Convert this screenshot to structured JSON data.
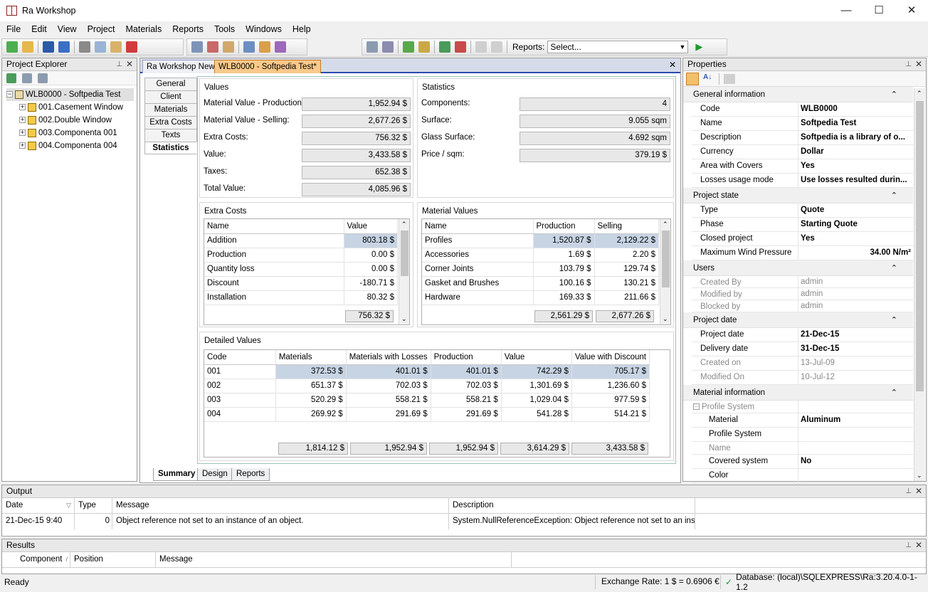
{
  "window": {
    "title": "Ra Workshop",
    "minimize": "—",
    "maximize": "☐",
    "close": "✕"
  },
  "menu": [
    "File",
    "Edit",
    "View",
    "Project",
    "Materials",
    "Reports",
    "Tools",
    "Windows",
    "Help"
  ],
  "toolbar": {
    "reports_label": "Reports:",
    "reports_select": "Select..."
  },
  "explorer": {
    "title": "Project Explorer",
    "root": "WLB0000 - Softpedia Test",
    "items": [
      "001.Casement Window",
      "002.Double Window",
      "003.Componenta 001",
      "004.Componenta 004"
    ]
  },
  "doc_tabs": [
    "Ra Workshop News",
    "WLB0000 - Softpedia Test*"
  ],
  "side_tabs": [
    "General",
    "Client",
    "Materials",
    "Extra Costs",
    "Texts",
    "Statistics"
  ],
  "values": {
    "title": "Values",
    "rows": [
      {
        "label": "Material Value - Production:",
        "value": "1,952.94 $"
      },
      {
        "label": "Material Value - Selling:",
        "value": "2,677.26 $"
      },
      {
        "label": "Extra Costs:",
        "value": "756.32 $"
      },
      {
        "label": "Value:",
        "value": "3,433.58 $"
      },
      {
        "label": "Taxes:",
        "value": "652.38 $"
      },
      {
        "label": "Total Value:",
        "value": "4,085.96 $"
      }
    ]
  },
  "statistics": {
    "title": "Statistics",
    "rows": [
      {
        "label": "Components:",
        "value": "4"
      },
      {
        "label": "Surface:",
        "value": "9.055 sqm"
      },
      {
        "label": "Glass Surface:",
        "value": "4.692 sqm"
      },
      {
        "label": "Price / sqm:",
        "value": "379.19 $"
      }
    ]
  },
  "extra_costs": {
    "title": "Extra Costs",
    "headers": [
      "Name",
      "Value"
    ],
    "rows": [
      [
        "Addition",
        "803.18 $"
      ],
      [
        "Production",
        "0.00 $"
      ],
      [
        "Quantity loss",
        "0.00 $"
      ],
      [
        "Discount",
        "-180.71 $"
      ],
      [
        "Installation",
        "80.32 $"
      ]
    ],
    "total": "756.32 $"
  },
  "material_values": {
    "title": "Material Values",
    "headers": [
      "Name",
      "Production",
      "Selling"
    ],
    "rows": [
      [
        "Profiles",
        "1,520.87 $",
        "2,129.22 $"
      ],
      [
        "Accessories",
        "1.69 $",
        "2.20 $"
      ],
      [
        "Corner Joints",
        "103.79 $",
        "129.74 $"
      ],
      [
        "Gasket and Brushes",
        "100.16 $",
        "130.21 $"
      ],
      [
        "Hardware",
        "169.33 $",
        "211.66 $"
      ]
    ],
    "totals": [
      "2,561.29 $",
      "2,677.26 $"
    ]
  },
  "detailed_values": {
    "title": "Detailed Values",
    "headers": [
      "Code",
      "Materials",
      "Materials with Losses",
      "Production",
      "Value",
      "Value with Discount"
    ],
    "rows": [
      [
        "001",
        "372.53 $",
        "401.01 $",
        "401.01 $",
        "742.29 $",
        "705.17 $"
      ],
      [
        "002",
        "651.37 $",
        "702.03 $",
        "702.03 $",
        "1,301.69 $",
        "1,236.60 $"
      ],
      [
        "003",
        "520.29 $",
        "558.21 $",
        "558.21 $",
        "1,029.04 $",
        "977.59 $"
      ],
      [
        "004",
        "269.92 $",
        "291.69 $",
        "291.69 $",
        "541.28 $",
        "514.21 $"
      ]
    ],
    "totals": [
      "1,814.12 $",
      "1,952.94 $",
      "1,952.94 $",
      "3,614.29 $",
      "3,433.58 $"
    ]
  },
  "bottom_tabs": [
    "Summary",
    "Design",
    "Reports"
  ],
  "properties": {
    "title": "Properties",
    "general_info": "General information",
    "code_label": "Code",
    "code": "WLB0000",
    "name_label": "Name",
    "name": "Softpedia Test",
    "description_label": "Description",
    "description": "Softpedia is a library of o...",
    "currency_label": "Currency",
    "currency": "Dollar",
    "area_covers_label": "Area with Covers",
    "area_covers": "Yes",
    "losses_label": "Losses usage mode",
    "losses": "Use losses resulted durin...",
    "project_state": "Project state",
    "type_label": "Type",
    "type": "Quote",
    "phase_label": "Phase",
    "phase": "Starting Quote",
    "closed_label": "Closed project",
    "closed": "Yes",
    "wind_label": "Maximum Wind Pressure",
    "wind": "34.00 N/m²",
    "users": "Users",
    "created_by_label": "Created By",
    "created_by": "admin",
    "modified_by_label": "Modified by",
    "modified_by": "admin",
    "blocked_by_label": "Blocked by",
    "blocked_by": "admin",
    "project_date_cat": "Project date",
    "project_date_label": "Project date",
    "project_date": "21-Dec-15",
    "delivery_label": "Delivery date",
    "delivery": "31-Dec-15",
    "created_on_label": "Created on",
    "created_on": "13-Jul-09",
    "modified_on_label": "Modified On",
    "modified_on": "10-Jul-12",
    "material_info": "Material information",
    "profile_system_group": "Profile System",
    "material_label": "Material",
    "material": "Aluminum",
    "profile_system_label": "Profile System",
    "ps_name_label": "Name",
    "covered_label": "Covered system",
    "covered": "No",
    "color_label": "Color"
  },
  "output": {
    "title": "Output",
    "headers": [
      "Date",
      "Type",
      "Message",
      "Description"
    ],
    "row": [
      "21-Dec-15 9:40",
      "0",
      "Object reference not set to an instance of an object.",
      "System.NullReferenceException: Object reference not set to an inst..."
    ]
  },
  "results": {
    "title": "Results",
    "headers": [
      "Component",
      "Position",
      "Message"
    ]
  },
  "status": {
    "ready": "Ready",
    "exchange": "Exchange Rate: 1 $ = 0.6906 €",
    "database": "Database: (local)\\SQLEXPRESS\\Ra:3.20.4.0-1-1.2"
  }
}
